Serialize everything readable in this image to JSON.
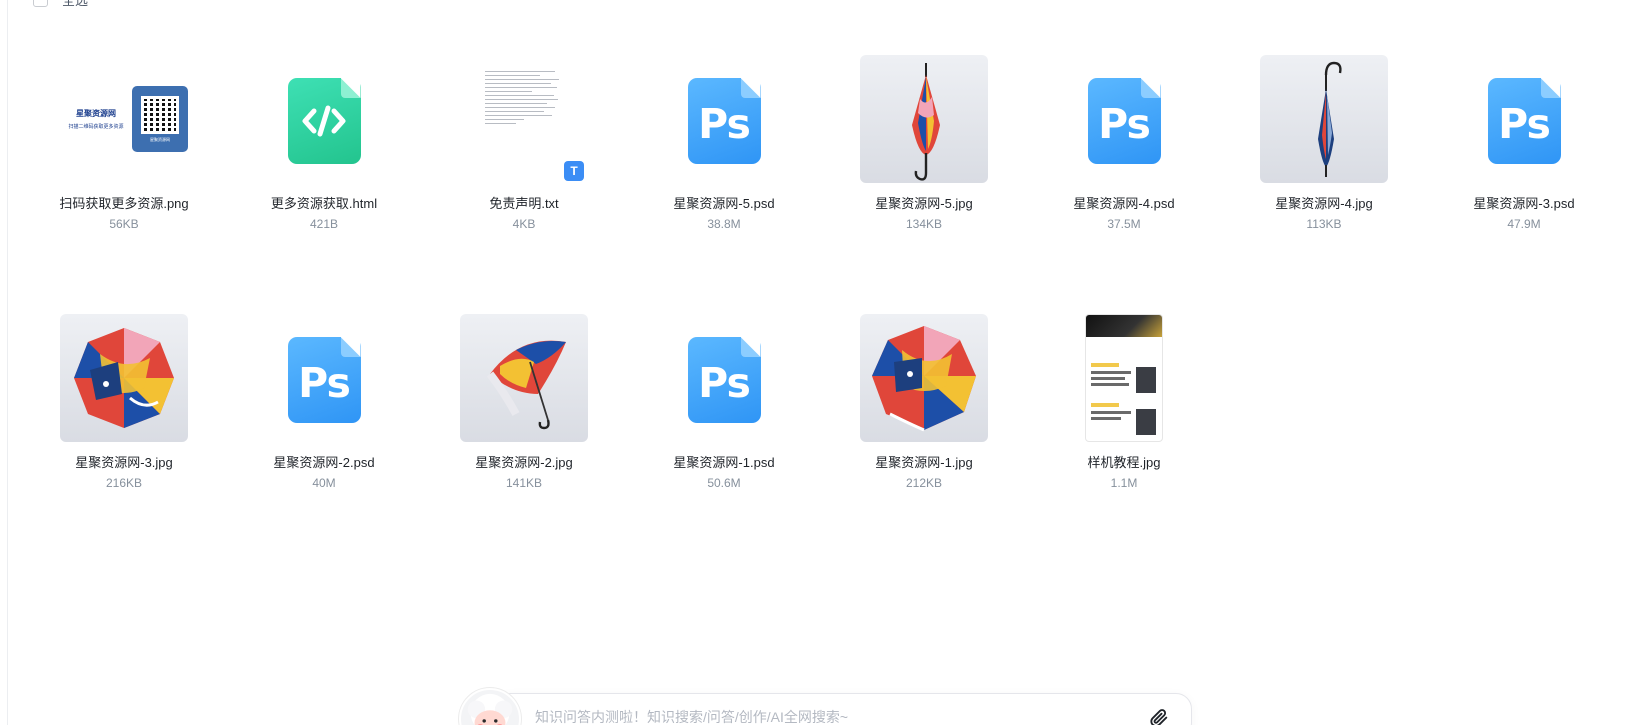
{
  "toolbar": {
    "select_all_label": "全选"
  },
  "files": [
    {
      "name": "扫码获取更多资源.png",
      "size": "56KB",
      "kind": "qr-image"
    },
    {
      "name": "更多资源获取.html",
      "size": "421B",
      "kind": "html-icon"
    },
    {
      "name": "免责声明.txt",
      "size": "4KB",
      "kind": "txt-preview"
    },
    {
      "name": "星聚资源网-5.psd",
      "size": "38.8M",
      "kind": "ps-icon"
    },
    {
      "name": "星聚资源网-5.jpg",
      "size": "134KB",
      "kind": "photo-umbrella-closed"
    },
    {
      "name": "星聚资源网-4.psd",
      "size": "37.5M",
      "kind": "ps-icon"
    },
    {
      "name": "星聚资源网-4.jpg",
      "size": "113KB",
      "kind": "photo-umbrella-stick"
    },
    {
      "name": "星聚资源网-3.psd",
      "size": "47.9M",
      "kind": "ps-icon"
    },
    {
      "name": "星聚资源网-3.jpg",
      "size": "216KB",
      "kind": "photo-umbrella-open"
    },
    {
      "name": "星聚资源网-2.psd",
      "size": "40M",
      "kind": "ps-icon"
    },
    {
      "name": "星聚资源网-2.jpg",
      "size": "141KB",
      "kind": "photo-umbrella-side"
    },
    {
      "name": "星聚资源网-1.psd",
      "size": "50.6M",
      "kind": "ps-icon"
    },
    {
      "name": "星聚资源网-1.jpg",
      "size": "212KB",
      "kind": "photo-umbrella-open"
    },
    {
      "name": "样机教程.jpg",
      "size": "1.1M",
      "kind": "tutorial-image"
    }
  ],
  "thumb_text": {
    "ps_label": "Ps",
    "txt_badge": "T",
    "qr_logo": "星聚资源网",
    "qr_sub": "扫描二维码获取更多资源",
    "qr_caption": "星聚资源网"
  },
  "chat": {
    "placeholder": "知识问答内测啦！知识搜索/问答/创作/AI全网搜索~"
  },
  "colors": {
    "ps_blue": "#2f95f5",
    "html_green": "#23c48e",
    "txt_badge_blue": "#3b8df5",
    "umbrella_red": "#e0463a",
    "umbrella_blue": "#1d4fa8",
    "umbrella_yellow": "#f3c133"
  }
}
